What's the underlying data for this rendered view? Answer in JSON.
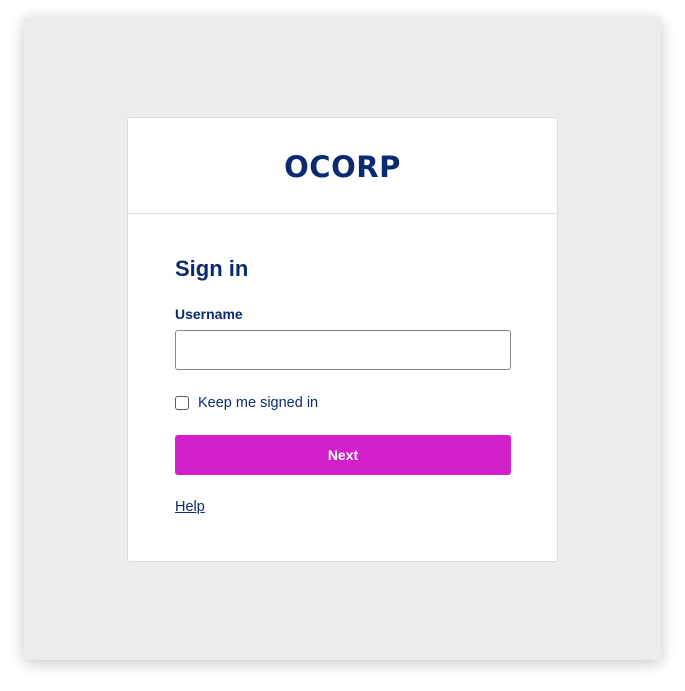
{
  "brand": {
    "logo_text": "OCORP",
    "color": "#0b2a6f"
  },
  "form": {
    "title": "Sign in",
    "username_label": "Username",
    "username_value": "",
    "username_placeholder": "",
    "keep_signed_in_label": "Keep me signed in",
    "keep_signed_in_checked": false,
    "next_label": "Next",
    "help_label": "Help"
  },
  "colors": {
    "accent": "#d31fcb",
    "text": "#0b2a6f",
    "background": "#ececec"
  }
}
